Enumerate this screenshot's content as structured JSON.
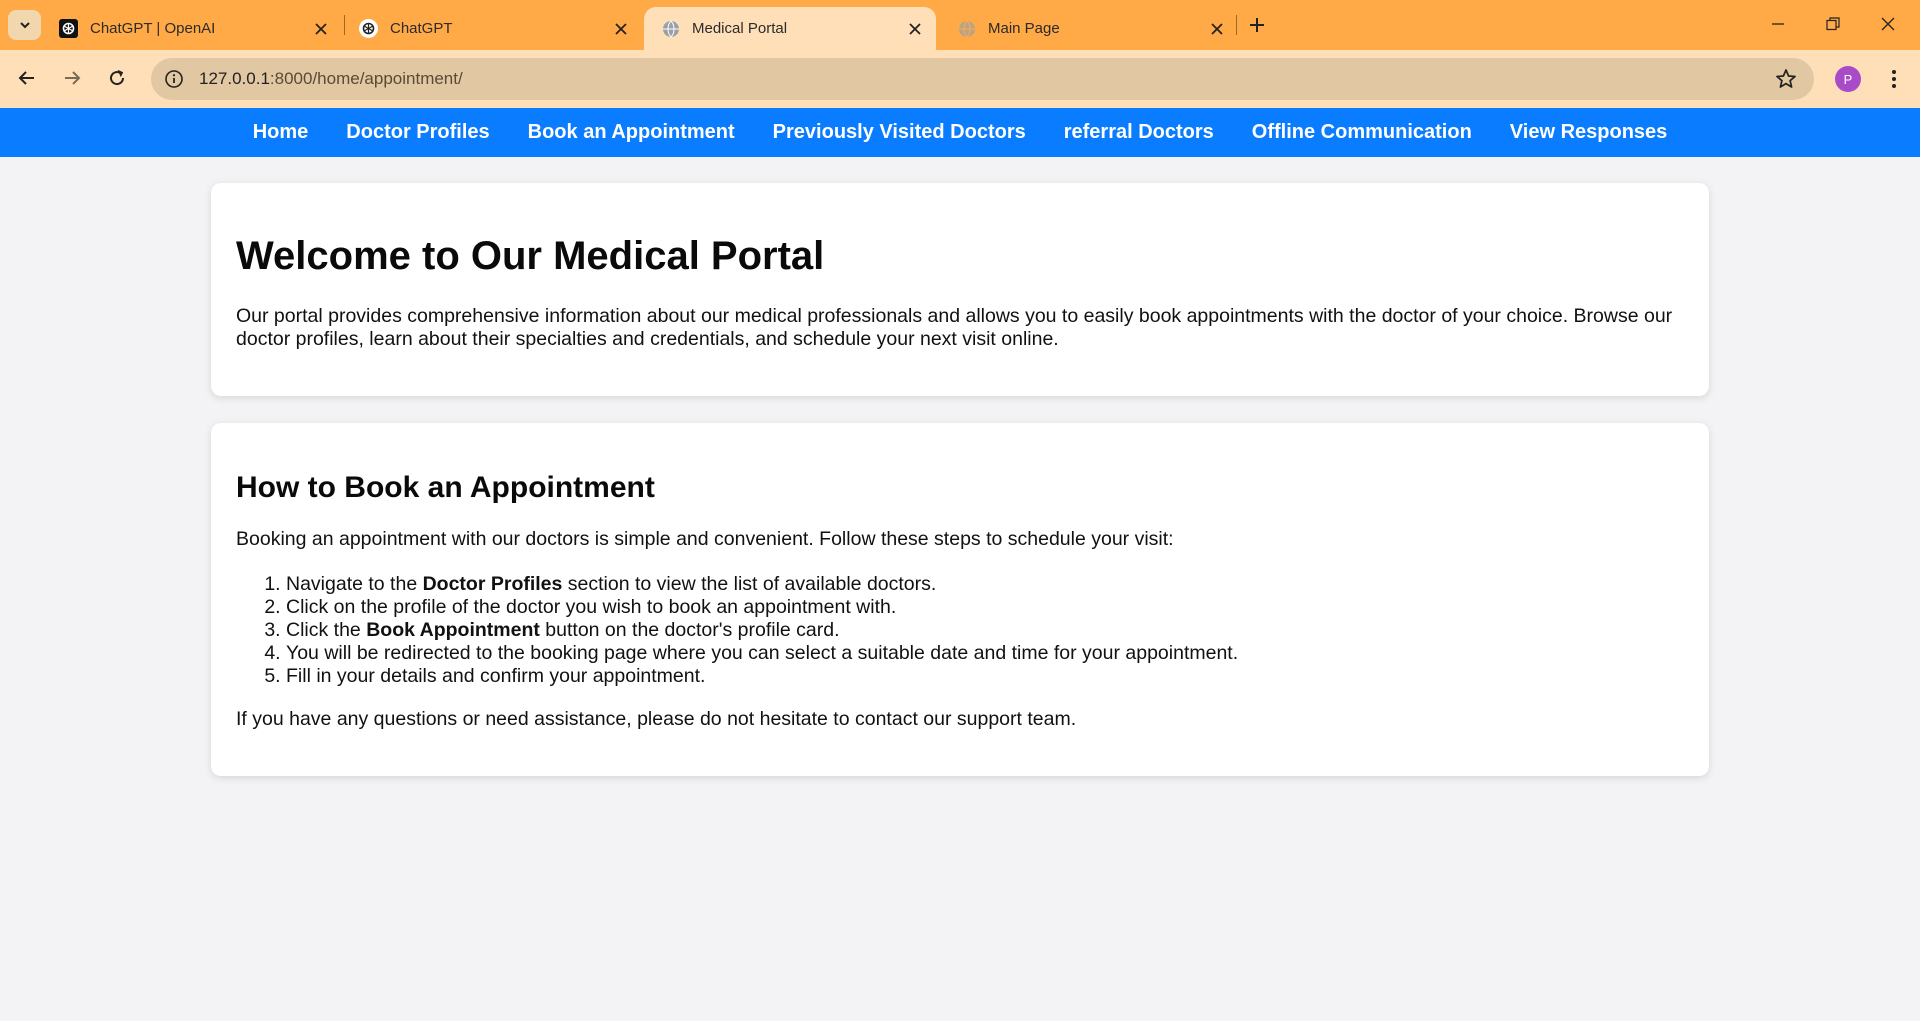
{
  "browser": {
    "tabs": [
      {
        "title": "ChatGPT | OpenAI",
        "favicon": "openai-icon",
        "active": false
      },
      {
        "title": "ChatGPT",
        "favicon": "openai-icon",
        "active": false
      },
      {
        "title": "Medical Portal",
        "favicon": "globe-icon",
        "active": true
      },
      {
        "title": "Main Page",
        "favicon": "globe-icon",
        "active": false
      }
    ],
    "url_host": "127.0.0.1",
    "url_path": ":8000/home/appointment/",
    "profile_initial": "P",
    "colors": {
      "tabstrip": "#ffaa46",
      "toolbar": "#ffdfb8",
      "omnibox": "#e2c7a3"
    }
  },
  "nav": {
    "items": [
      "Home",
      "Doctor Profiles",
      "Book an Appointment",
      "Previously Visited Doctors",
      "referral Doctors",
      "Offline Communication",
      "View Responses"
    ],
    "color": "#0a7cff"
  },
  "welcome": {
    "heading": "Welcome to Our Medical Portal",
    "text": "Our portal provides comprehensive information about our medical professionals and allows you to easily book appointments with the doctor of your choice. Browse our doctor profiles, learn about their specialties and credentials, and schedule your next visit online."
  },
  "howto": {
    "heading": "How to Book an Appointment",
    "intro": "Booking an appointment with our doctors is simple and convenient. Follow these steps to schedule your visit:",
    "steps": [
      {
        "pre": "Navigate to the ",
        "bold": "Doctor Profiles",
        "post": " section to view the list of available doctors."
      },
      {
        "pre": "Click on the profile of the doctor you wish to book an appointment with.",
        "bold": "",
        "post": ""
      },
      {
        "pre": "Click the ",
        "bold": "Book Appointment",
        "post": " button on the doctor's profile card."
      },
      {
        "pre": "You will be redirected to the booking page where you can select a suitable date and time for your appointment.",
        "bold": "",
        "post": ""
      },
      {
        "pre": "Fill in your details and confirm your appointment.",
        "bold": "",
        "post": ""
      }
    ],
    "outro": "If you have any questions or need assistance, please do not hesitate to contact our support team."
  }
}
